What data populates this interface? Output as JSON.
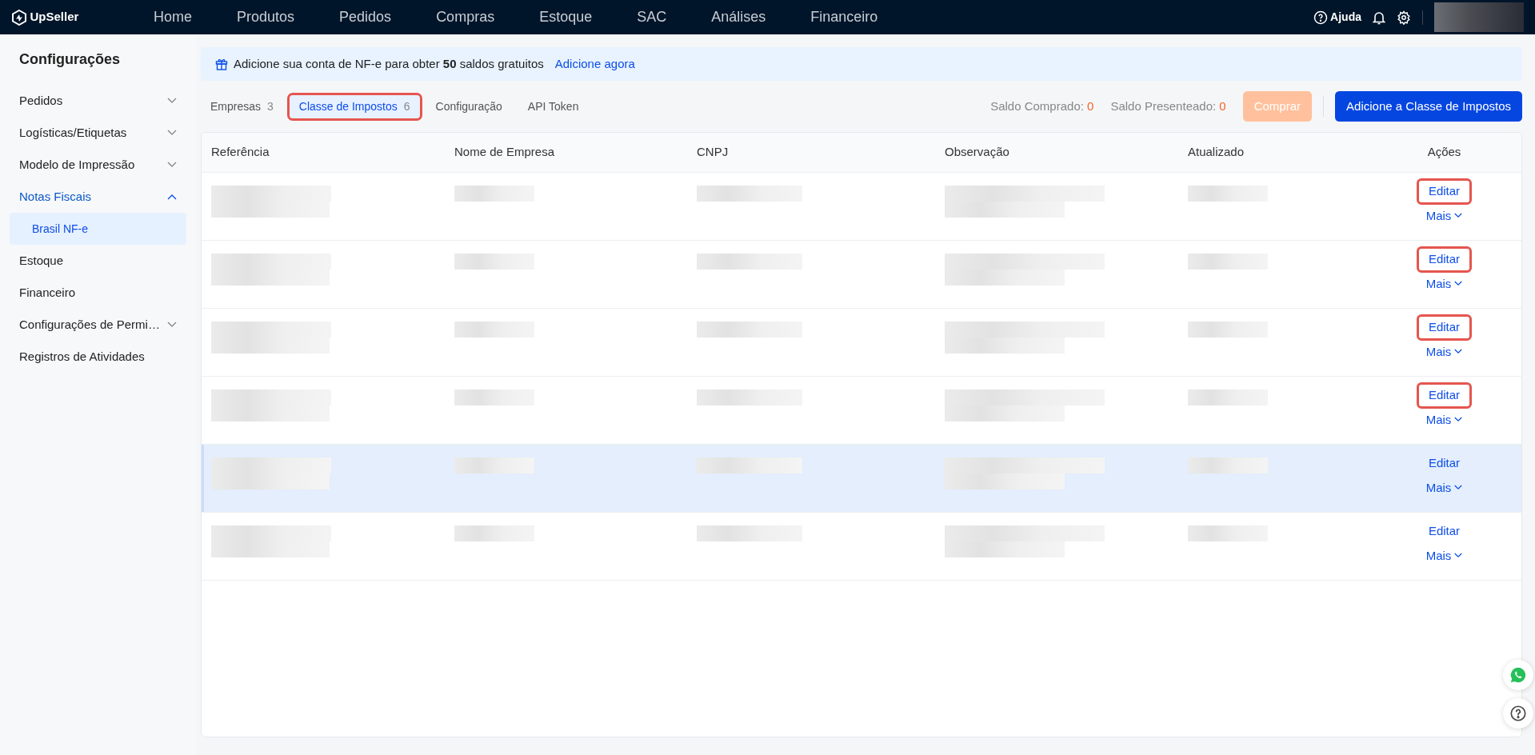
{
  "brand": {
    "name": "UpSeller"
  },
  "top_nav": [
    {
      "label": "Home"
    },
    {
      "label": "Produtos"
    },
    {
      "label": "Pedidos"
    },
    {
      "label": "Compras"
    },
    {
      "label": "Estoque"
    },
    {
      "label": "SAC"
    },
    {
      "label": "Análises"
    },
    {
      "label": "Financeiro"
    }
  ],
  "top_right": {
    "help": "Ajuda"
  },
  "sidebar": {
    "title": "Configurações",
    "items": [
      {
        "label": "Pedidos",
        "expanded": false
      },
      {
        "label": "Logísticas/Etiquetas",
        "expanded": false
      },
      {
        "label": "Modelo de Impressão",
        "expanded": false
      },
      {
        "label": "Notas Fiscais",
        "expanded": true,
        "children": [
          {
            "label": "Brasil NF-e",
            "selected": true
          }
        ]
      },
      {
        "label": "Estoque"
      },
      {
        "label": "Financeiro"
      },
      {
        "label": "Configurações de Permi…",
        "expanded": false
      },
      {
        "label": "Registros de Atividades"
      }
    ]
  },
  "banner": {
    "text": "Adicione sua conta de NF-e para obter **50** saldos gratuitos",
    "link": "Adicione agora"
  },
  "tabs": [
    {
      "label": "Empresas",
      "count": "3",
      "selected": false,
      "outlined": false
    },
    {
      "label": "Classe de Impostos",
      "count": "6",
      "selected": true,
      "outlined": true
    },
    {
      "label": "Configuração",
      "selected": false,
      "outlined": false
    },
    {
      "label": "API Token",
      "selected": false,
      "outlined": false
    }
  ],
  "balances": [
    {
      "label": "Saldo Comprado:",
      "value": "0"
    },
    {
      "label": "Saldo Presenteado:",
      "value": "0"
    }
  ],
  "buttons": {
    "buy": {
      "label": "Comprar",
      "disabled": true
    },
    "add": {
      "label": "Adicione a Classe de Impostos"
    }
  },
  "table": {
    "columns": [
      "Referência",
      "Nome de Empresa",
      "CNPJ",
      "Observação",
      "Atualizado",
      "Ações"
    ],
    "rows": [
      {
        "edit": "Editar",
        "more": "Mais",
        "edit_outlined": true,
        "hovered": false
      },
      {
        "edit": "Editar",
        "more": "Mais",
        "edit_outlined": true,
        "hovered": false
      },
      {
        "edit": "Editar",
        "more": "Mais",
        "edit_outlined": true,
        "hovered": false
      },
      {
        "edit": "Editar",
        "more": "Mais",
        "edit_outlined": true,
        "hovered": false
      },
      {
        "edit": "Editar",
        "more": "Mais",
        "edit_outlined": false,
        "hovered": true
      },
      {
        "edit": "Editar",
        "more": "Mais",
        "edit_outlined": false,
        "hovered": false
      }
    ]
  }
}
